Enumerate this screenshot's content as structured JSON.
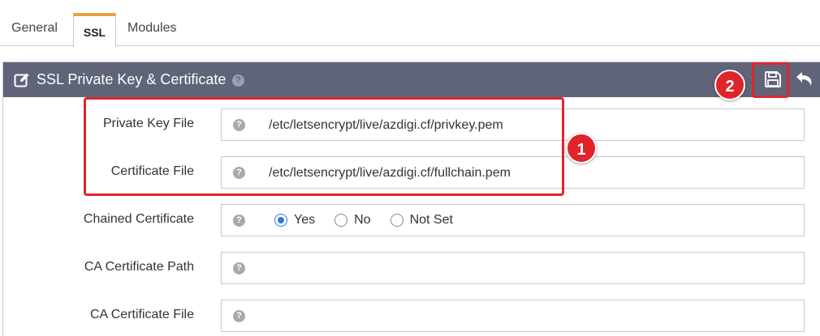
{
  "tabs": [
    {
      "label": "General",
      "active": false
    },
    {
      "label": "SSL",
      "active": true
    },
    {
      "label": "Modules",
      "active": false
    }
  ],
  "panel": {
    "title": "SSL Private Key & Certificate",
    "help_icon": "question-circle-icon",
    "actions": {
      "save_icon": "floppy-disk-icon",
      "back_icon": "undo-arrow-icon"
    }
  },
  "fields": [
    {
      "label": "Private Key File",
      "value": "/etc/letsencrypt/live/azdigi.cf/privkey.pem"
    },
    {
      "label": "Certificate File",
      "value": "/etc/letsencrypt/live/azdigi.cf/fullchain.pem"
    },
    {
      "label": "Chained Certificate",
      "options": [
        "Yes",
        "No",
        "Not Set"
      ],
      "selected": "Yes"
    },
    {
      "label": "CA Certificate Path",
      "value": ""
    },
    {
      "label": "CA Certificate File",
      "value": ""
    }
  ],
  "annotations": [
    {
      "number": "1"
    },
    {
      "number": "2"
    }
  ],
  "colors": {
    "header_bg": "#5f6479",
    "active_tab_accent": "#e8a33d",
    "annotation_red": "#e0242c",
    "radio_blue": "#2b7bd8"
  }
}
